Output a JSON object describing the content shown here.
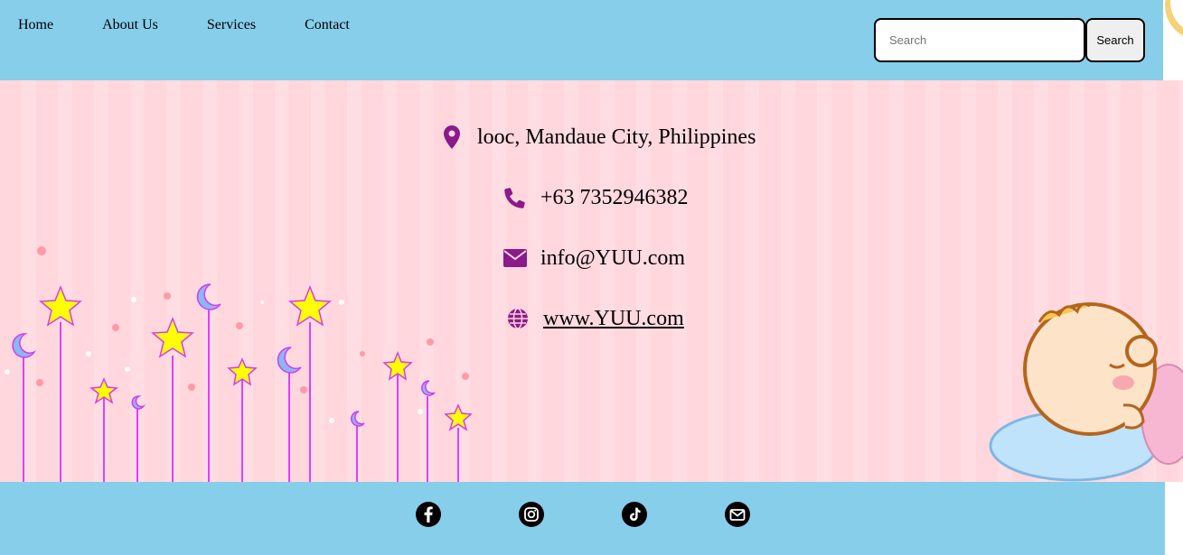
{
  "nav": {
    "items": [
      "Home",
      "About Us",
      "Services",
      "Contact"
    ]
  },
  "search": {
    "placeholder": "Search",
    "button_label": "Search"
  },
  "contact": {
    "address": "looc, Mandaue City, Philippines",
    "phone": "+63 7352946382",
    "email": "info@YUU.com",
    "website": "www.YUU.com"
  },
  "icons": {
    "address": "map-pin-icon",
    "phone": "phone-icon",
    "email": "envelope-icon",
    "website": "globe-icon"
  },
  "social": [
    "facebook-icon",
    "instagram-icon",
    "tiktok-icon",
    "mail-icon"
  ],
  "colors": {
    "header_bg": "#87CEEB",
    "footer_bg": "#87CEEB",
    "main_bg": "#FFD7DC",
    "icon_accent": "#8B1A8B"
  }
}
